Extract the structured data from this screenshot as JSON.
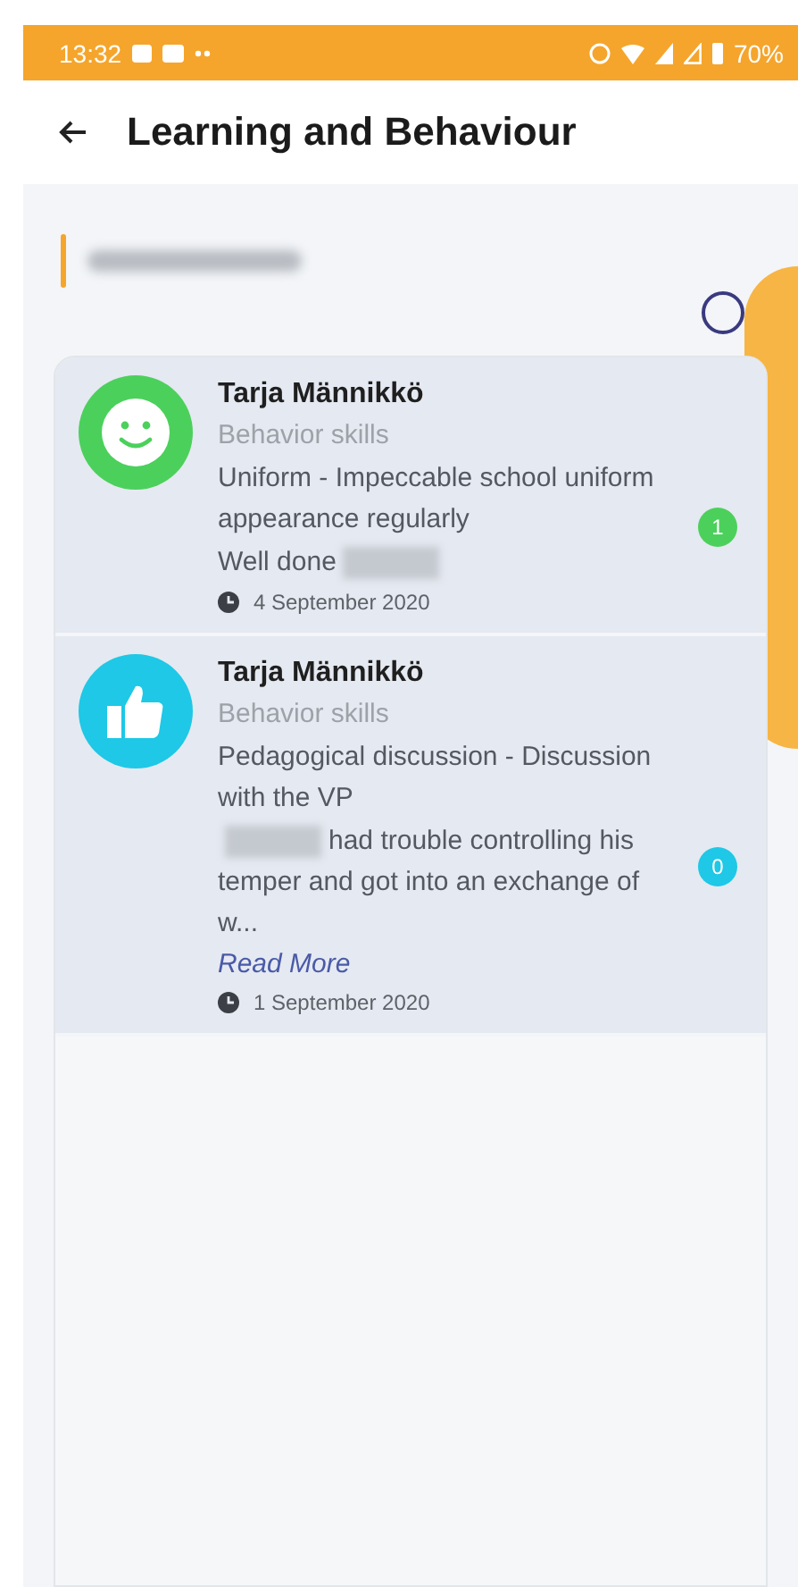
{
  "status_bar": {
    "time": "13:32",
    "battery": "70%"
  },
  "header": {
    "title": "Learning and Behaviour"
  },
  "entries": [
    {
      "kind": "smiley",
      "color": "#4cd05c",
      "author": "Tarja Männikkö",
      "category": "Behavior skills",
      "title": "Uniform - Impeccable school uniform appearance regularly",
      "comment": [
        {
          "kind": "text",
          "text": "Well done"
        },
        {
          "kind": "redacted"
        }
      ],
      "count": "1",
      "date": "4 September 2020"
    },
    {
      "kind": "thumbs-up",
      "color": "#1ec8e6",
      "author": "Tarja Männikkö",
      "category": "Behavior skills",
      "title": "Pedagogical discussion - Discussion with the VP",
      "comment": [
        {
          "kind": "redacted"
        },
        {
          "kind": "text",
          "text": "had trouble controlling his temper and got into an exchange of w..."
        }
      ],
      "read_more": "Read More",
      "count": "0",
      "date": "1 September 2020"
    }
  ]
}
